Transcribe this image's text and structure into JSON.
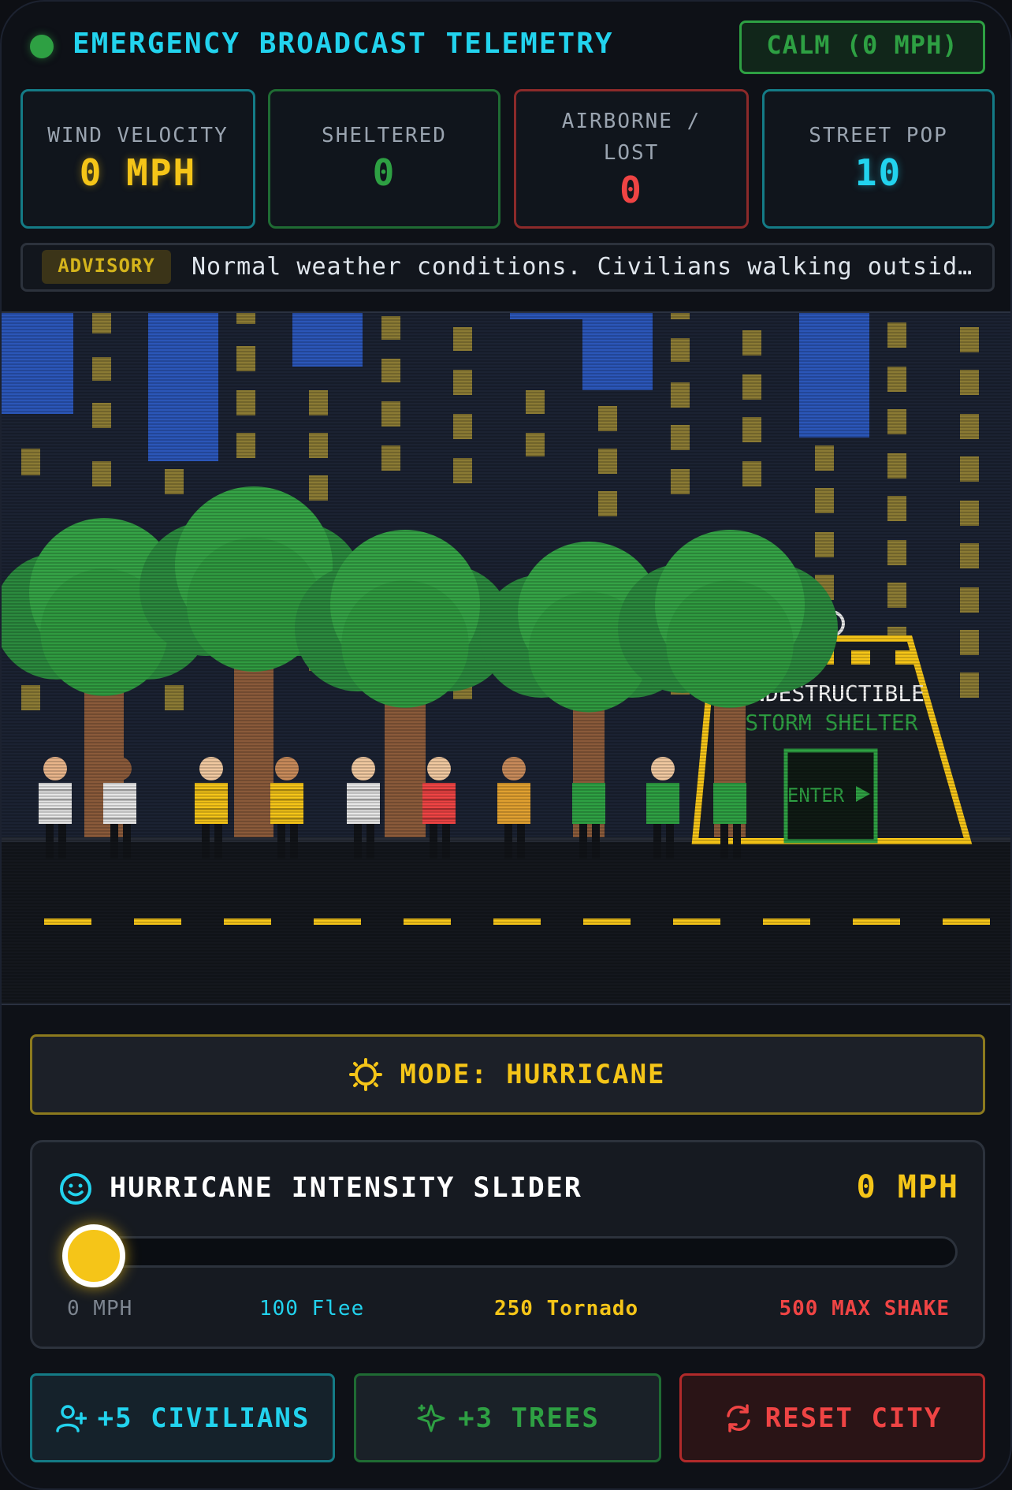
{
  "header": {
    "title": "EMERGENCY BROADCAST TELEMETRY",
    "status": "CALM (0 MPH)"
  },
  "stats": {
    "wind": {
      "label": "WIND VELOCITY",
      "value": "0 MPH",
      "color": "#f5c518"
    },
    "sheltered": {
      "label": "SHELTERED",
      "value": "0",
      "color": "#2ea043"
    },
    "airborne": {
      "label_line1": "AIRBORNE /",
      "label_line2": "LOST",
      "value": "0",
      "color": "#ef4444"
    },
    "street": {
      "label": "STREET POP",
      "value": "10",
      "color": "#22d3ee"
    }
  },
  "advisory": {
    "badge": "ADVISORY",
    "text": "Normal weather conditions. Civilians walking outside."
  },
  "scene": {
    "shelter_line1": "INDESTRUCTIBLE",
    "shelter_line2": "STORM SHELTER",
    "enter_label": "ENTER",
    "civilian_count": 10,
    "tree_count": 5
  },
  "mode": {
    "label": "MODE: HURRICANE",
    "icon": "sun-icon"
  },
  "slider": {
    "title": "HURRICANE INTENSITY SLIDER",
    "icon": "smile-icon",
    "value_label": "0 MPH",
    "value": 0,
    "min": 0,
    "max": 500,
    "ticks": [
      "0 MPH",
      "100 Flee",
      "250 Tornado",
      "500 MAX SHAKE"
    ]
  },
  "buttons": {
    "add_civilians": {
      "label": "+5 CIVILIANS",
      "icon": "user-plus-icon"
    },
    "add_trees": {
      "label": "+3 TREES",
      "icon": "sparkle-icon"
    },
    "reset": {
      "label": "RESET CITY",
      "icon": "refresh-icon"
    }
  },
  "colors": {
    "accent_cyan": "#22d3ee",
    "accent_yellow": "#f5c518",
    "accent_green": "#2ea043",
    "accent_red": "#ef4444"
  }
}
